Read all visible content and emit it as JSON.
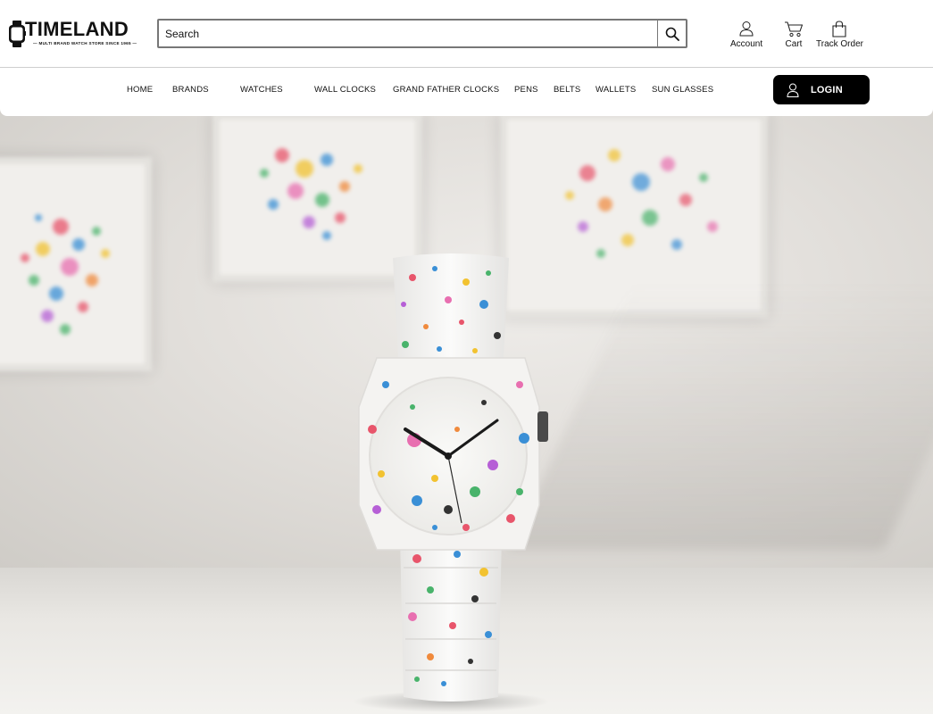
{
  "brand": {
    "name": "TIMELAND",
    "tagline": "— MULTI BRAND WATCH STORE SINCE 1965 —"
  },
  "search": {
    "placeholder": "Search",
    "value": ""
  },
  "header_actions": [
    {
      "label": "Account",
      "icon": "user-icon"
    },
    {
      "label": "Cart",
      "icon": "cart-icon"
    },
    {
      "label": "Track Order",
      "icon": "bag-icon"
    }
  ],
  "nav": {
    "items": [
      {
        "label": "HOME"
      },
      {
        "label": "BRANDS"
      },
      {
        "label": "WATCHES"
      },
      {
        "label": "WALL CLOCKS"
      },
      {
        "label": "GRAND FATHER CLOCKS"
      },
      {
        "label": "PENS"
      },
      {
        "label": "BELTS"
      },
      {
        "label": "WALLETS"
      },
      {
        "label": "SUN GLASSES"
      }
    ],
    "login_label": "LOGIN"
  },
  "colors": {
    "text": "#111111",
    "login_bg": "#000000",
    "login_text": "#ffffff",
    "border": "#777777"
  }
}
